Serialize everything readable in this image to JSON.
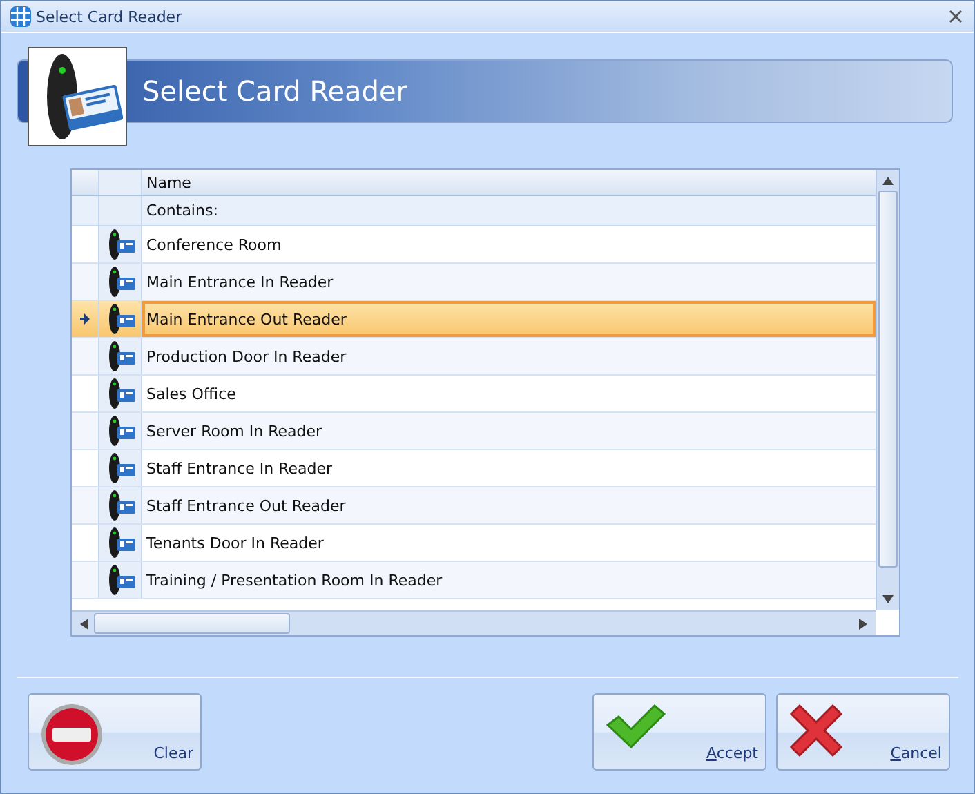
{
  "window": {
    "title": "Select Card Reader"
  },
  "header": {
    "title": "Select Card Reader"
  },
  "table": {
    "columns": [
      "Name"
    ],
    "filter_label": "Contains:",
    "rows": [
      {
        "name": "Conference Room",
        "selected": false
      },
      {
        "name": "Main Entrance In Reader",
        "selected": false
      },
      {
        "name": "Main Entrance Out Reader",
        "selected": true
      },
      {
        "name": "Production Door In Reader",
        "selected": false
      },
      {
        "name": "Sales Office",
        "selected": false
      },
      {
        "name": "Server Room In Reader",
        "selected": false
      },
      {
        "name": "Staff Entrance In Reader",
        "selected": false
      },
      {
        "name": "Staff Entrance Out Reader",
        "selected": false
      },
      {
        "name": "Tenants Door In Reader",
        "selected": false
      },
      {
        "name": "Training / Presentation Room In Reader",
        "selected": false
      }
    ]
  },
  "buttons": [
    {
      "kind": "clear",
      "label": "Clear",
      "underline_first": false
    },
    {
      "kind": "accept",
      "label": "Accept",
      "underline_first": true
    },
    {
      "kind": "cancel",
      "label": "Cancel",
      "underline_first": true
    }
  ]
}
